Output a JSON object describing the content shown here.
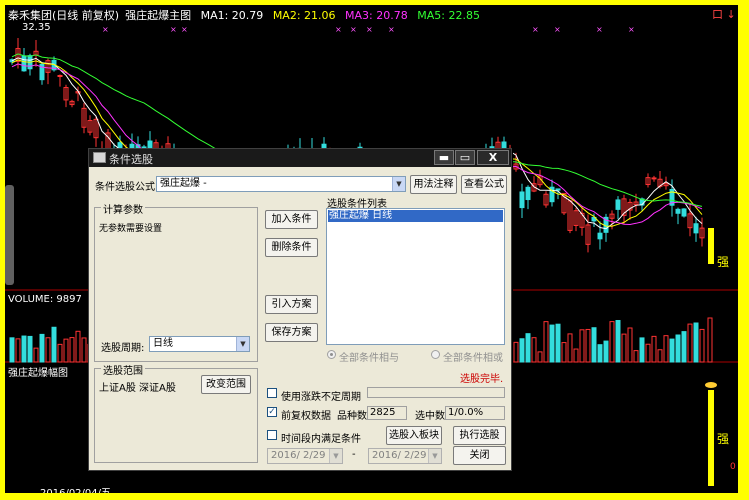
{
  "chart": {
    "title": {
      "stock": "秦禾集团(日线 前复权)",
      "indicator": "强庄起爆主图",
      "ma1": "MA1: 20.79",
      "ma2": "MA2: 21.06",
      "ma3": "MA3: 20.78",
      "ma5": "MA5: 22.85"
    },
    "high_price": "32.35",
    "volume_label": "VOLUME: 9897",
    "sub_indicator": "强庄起爆幅图",
    "date_label": "2016/02/04/五",
    "signal_text_upper": "强",
    "signal_text_lower": "强",
    "zero_label": "0",
    "corner_icon": "口 ↓",
    "marker": "×",
    "colors": {
      "up": "#ff3333",
      "down": "#33dddd",
      "ma1": "#ffffff",
      "ma2": "#ffff00",
      "ma3": "#ff33ff",
      "ma5": "#33ff33",
      "frame": "#ffff00"
    }
  },
  "dialog": {
    "title": "条件选股",
    "win_min": "▬",
    "win_max": "▭",
    "win_close": "X",
    "formula_label": "条件选股公式",
    "formula_value": "强庄起爆       -",
    "usage_button": "用法注释",
    "view_formula_button": "查看公式",
    "params_group": "计算参数",
    "params_text": "无参数需要设置",
    "add_condition": "加入条件",
    "remove_condition": "删除条件",
    "import_plan": "引入方案",
    "save_plan": "保存方案",
    "condition_list_label": "选股条件列表",
    "condition_items": [
      "强庄起爆   日线"
    ],
    "radio_and": "全部条件相与",
    "radio_or": "全部条件相或",
    "period_label": "选股周期:",
    "period_value": "日线",
    "range_group": "选股范围",
    "range_value": "上证A股  深证A股",
    "change_range": "改变范围",
    "status": "选股完毕.",
    "checkbox_uncertain": "使用涨跌不定周期",
    "checkbox_adjust": "前复权数据",
    "checkbox_adjust_checked": "✓",
    "stock_count_label": "品种数",
    "stock_count": "2825",
    "selected_label": "选中数",
    "selected_value": "1/0.0%",
    "checkbox_time": "时间段内满足条件",
    "to_block_button": "选股入板块",
    "execute_button": "执行选股",
    "date_from": "2016/ 2/29",
    "date_sep": "-",
    "date_to": "2016/ 2/29",
    "close_button": "关闭",
    "combo_arrow": "▼"
  }
}
